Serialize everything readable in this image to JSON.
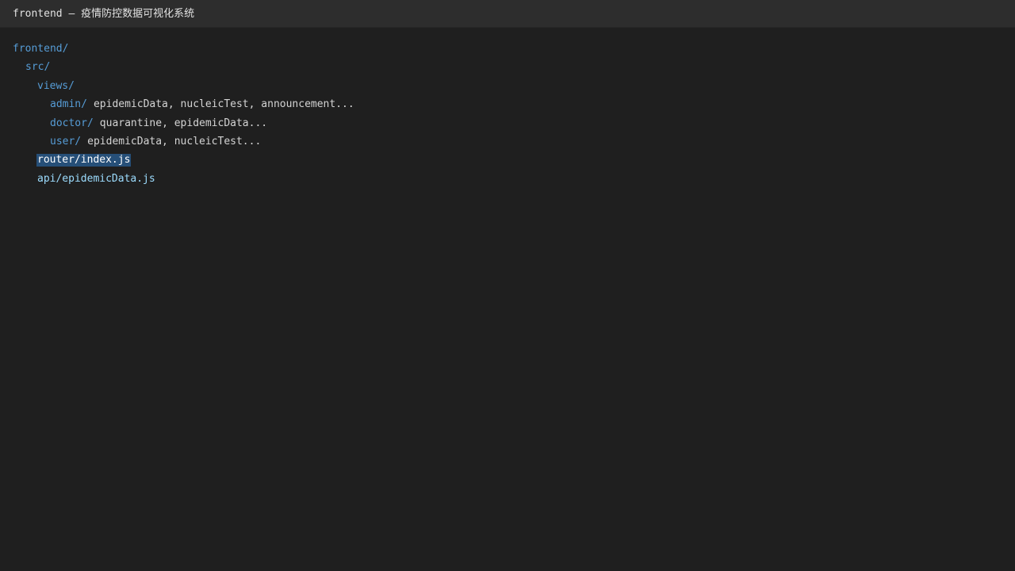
{
  "window": {
    "title": "frontend — 疫情防控数据可视化系统"
  },
  "tree": {
    "root": {
      "label": "frontend/"
    },
    "src": {
      "label": "src/"
    },
    "views": {
      "label": "views/"
    },
    "admin": {
      "label": "admin/",
      "contents": "epidemicData, nucleicTest, announcement..."
    },
    "doctor": {
      "label": "doctor/",
      "contents": "quarantine, epidemicData..."
    },
    "user": {
      "label": "user/",
      "contents": "epidemicData, nucleicTest..."
    },
    "router": {
      "label": "router/index.js",
      "selected": true
    },
    "api": {
      "label": "api/epidemicData.js"
    }
  },
  "colors": {
    "background": "#1f1f1f",
    "titlebar": "#2d2d2d",
    "folder": "#569cd6",
    "file": "#9cdcfe",
    "selection": "#264f78"
  }
}
